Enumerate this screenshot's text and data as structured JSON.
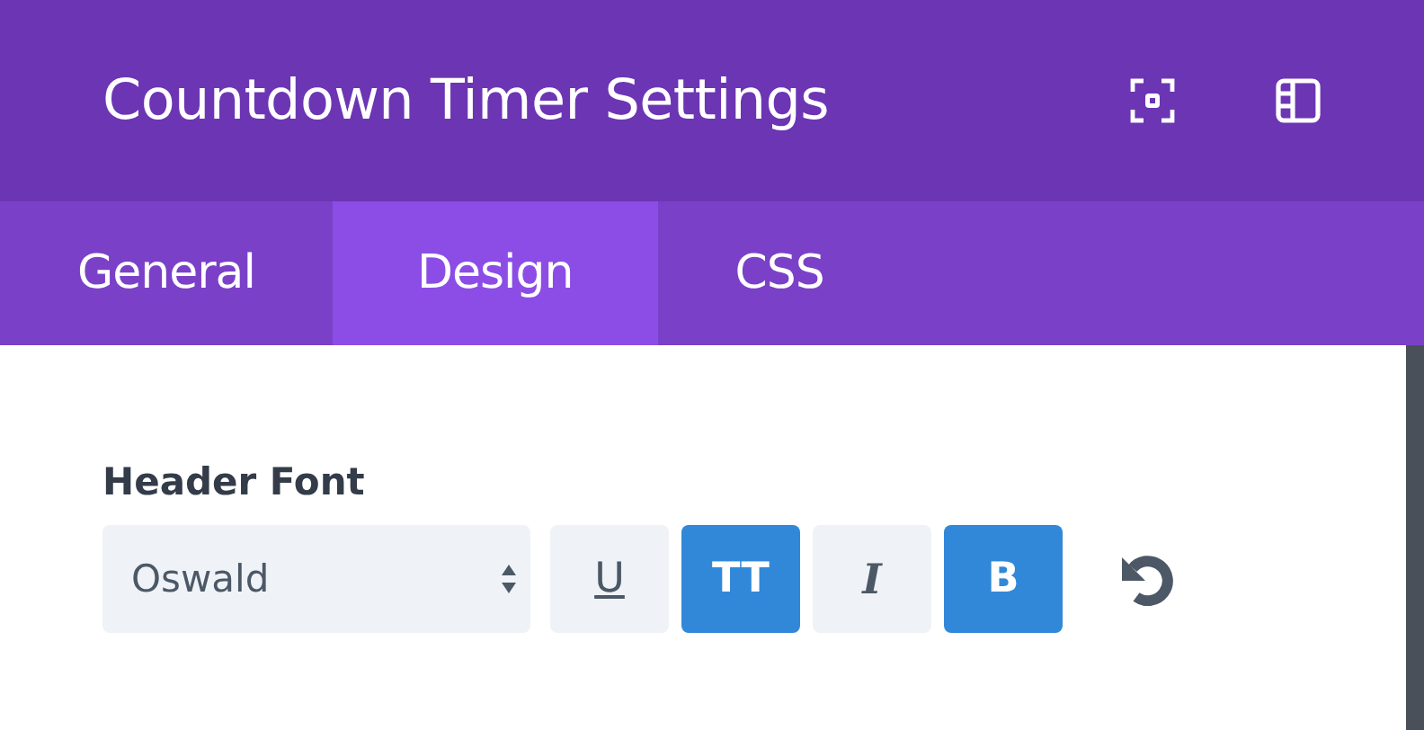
{
  "window": {
    "title": "Countdown Timer Settings"
  },
  "tabs": [
    {
      "label": "General",
      "selected": false
    },
    {
      "label": "Design",
      "selected": true
    },
    {
      "label": "CSS",
      "selected": false
    }
  ],
  "field": {
    "label": "Header Font",
    "value": "Oswald"
  },
  "format_buttons": [
    {
      "kind": "underline",
      "label": "U",
      "selected": false
    },
    {
      "kind": "uppercase",
      "label": "TT",
      "selected": true
    },
    {
      "kind": "italic",
      "label": "I",
      "selected": false
    },
    {
      "kind": "bold",
      "label": "B",
      "selected": true
    }
  ]
}
